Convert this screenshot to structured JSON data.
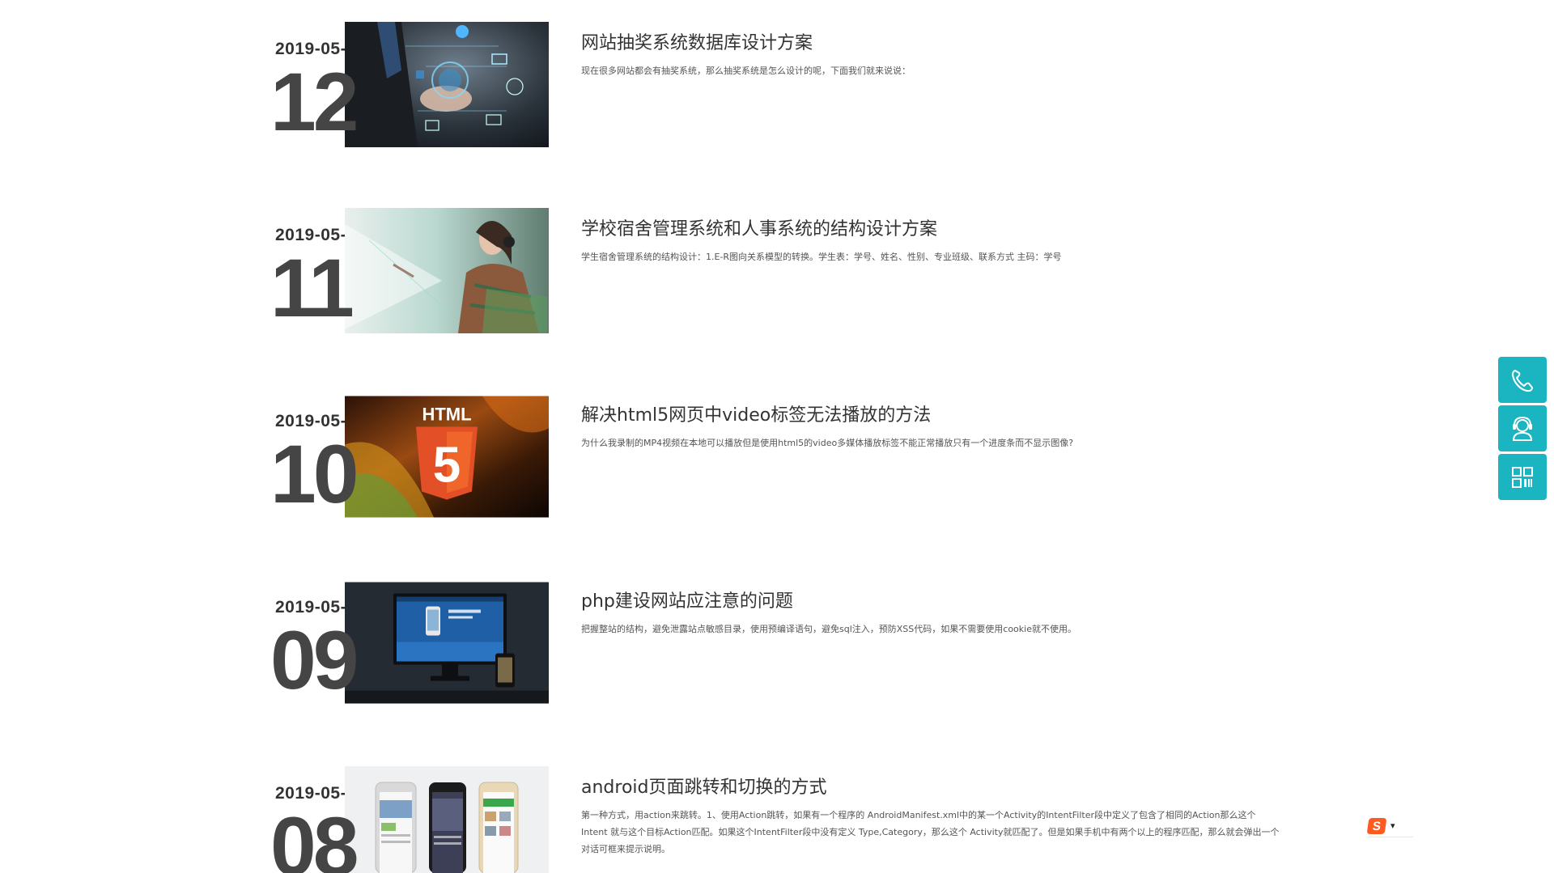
{
  "news": [
    {
      "month": "2019-05-",
      "day": "12",
      "title": "网站抽奖系统数据库设计方案",
      "desc": "现在很多网站都会有抽奖系统，那么抽奖系统是怎么设计的呢，下面我们就来说说：",
      "image": "business-tech-network"
    },
    {
      "month": "2019-05-",
      "day": "11",
      "title": "学校宿舍管理系统和人事系统的结构设计方案",
      "desc": "学生宿舍管理系统的结构设计：1.E-R图向关系模型的转换。学生表：学号、姓名、性别、专业班级、联系方式 主码：学号",
      "image": "woman-headphones"
    },
    {
      "month": "2019-05-",
      "day": "10",
      "title": "解决html5网页中video标签无法播放的方法",
      "desc": "为什么我录制的MP4视频在本地可以播放但是使用html5的video多媒体播放标签不能正常播放只有一个进度条而不显示图像?",
      "image": "html5-logo",
      "image_text": "HTML",
      "image_digit": "5"
    },
    {
      "month": "2019-05-",
      "day": "09",
      "title": "php建设网站应注意的问题",
      "desc": "把握整站的结构，避免泄露站点敏感目录，使用预编译语句，避免sql注入，预防XSS代码，如果不需要使用cookie就不使用。",
      "image": "desktop-mockup"
    },
    {
      "month": "2019-05-",
      "day": "08",
      "title": "android页面跳转和切换的方式",
      "desc": "第一种方式，用action来跳转。1、使用Action跳转，如果有一个程序的 AndroidManifest.xml中的某一个Activity的IntentFilter段中定义了包含了相同的Action那么这个Intent 就与这个目标Action匹配。如果这个IntentFilter段中没有定义 Type,Category，那么这个 Activity就匹配了。但是如果手机中有两个以上的程序匹配，那么就会弹出一个对话可框来提示说明。",
      "image": "phones-mockup"
    }
  ],
  "side_tools": [
    {
      "icon": "phone-icon"
    },
    {
      "icon": "customer-service-icon"
    },
    {
      "icon": "qrcode-icon"
    }
  ],
  "ime": {
    "logo": "S",
    "arrow": "▾"
  },
  "colors": {
    "side_tool_bg": "#1ab5c1",
    "ime_bg": "#ff5a1f",
    "day_color": "#454545"
  }
}
